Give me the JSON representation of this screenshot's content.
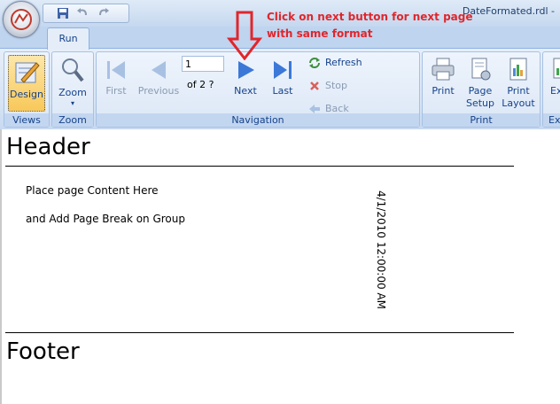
{
  "window": {
    "title": "DateFormated.rdl -"
  },
  "tabs": [
    {
      "label": "Run"
    }
  ],
  "groups": {
    "views": "Views",
    "zoom": "Zoom",
    "navigation": "Navigation",
    "print": "Print",
    "export": "Ex"
  },
  "buttons": {
    "design": "Design",
    "zoom": "Zoom",
    "first": "First",
    "previous": "Previous",
    "next": "Next",
    "last": "Last",
    "refresh": "Refresh",
    "stop": "Stop",
    "back": "Back",
    "print": "Print",
    "page_setup_line1": "Page",
    "page_setup_line2": "Setup",
    "print_layout_line1": "Print",
    "print_layout_line2": "Layout",
    "export_partial": "Ex"
  },
  "navigation": {
    "page_value": "1",
    "page_of": "of  2 ?"
  },
  "annotation": {
    "line1": "Click on next button for next page",
    "line2": "with same format"
  },
  "report": {
    "header": "Header",
    "content_line1": "Place page Content Here",
    "content_line2": "and Add Page Break on Group",
    "date_value": "4/1/2010 12:00:00 AM",
    "footer": "Footer"
  },
  "colors": {
    "annotation": "#e0262c",
    "ribbon_text": "#15428b",
    "ribbon_bg": "#dbe7f6"
  }
}
